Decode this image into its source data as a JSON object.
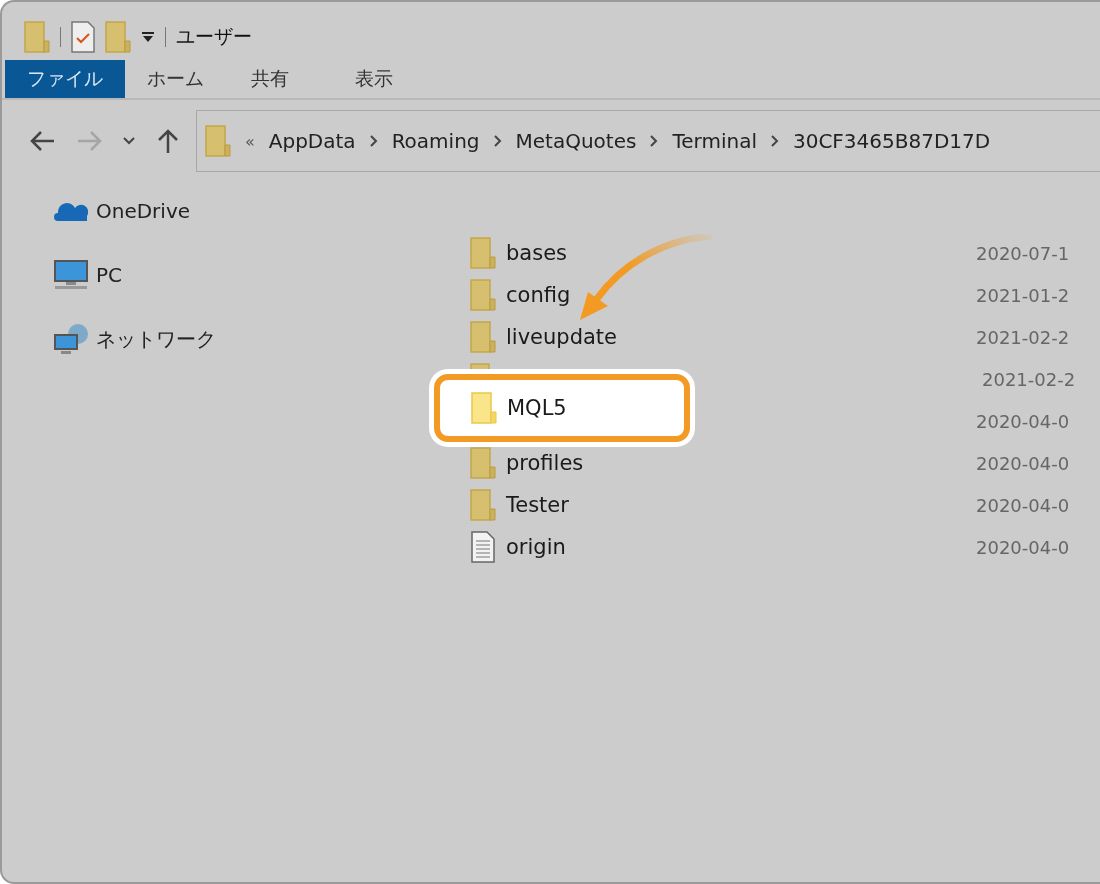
{
  "window": {
    "title": "ユーザー"
  },
  "ribbon_tabs": [
    {
      "label": "ファイル",
      "selected": true
    },
    {
      "label": "ホーム",
      "selected": false
    },
    {
      "label": "共有",
      "selected": false
    },
    {
      "label": "表示",
      "selected": false
    }
  ],
  "address_bar": {
    "overflow": "«",
    "path": [
      "AppData",
      "Roaming",
      "MetaQuotes",
      "Terminal",
      "30CF3465B87D17D"
    ]
  },
  "sidebar": {
    "items": [
      {
        "kind": "cloud",
        "label": "OneDrive"
      },
      {
        "kind": "pc",
        "label": "PC"
      },
      {
        "kind": "network",
        "label": "ネットワーク"
      }
    ]
  },
  "files": [
    {
      "kind": "folder",
      "name": "bases",
      "date": "2020-07-1",
      "highlighted": false
    },
    {
      "kind": "folder",
      "name": "config",
      "date": "2021-01-2",
      "highlighted": false
    },
    {
      "kind": "folder",
      "name": "liveupdate",
      "date": "2021-02-2",
      "highlighted": false
    },
    {
      "kind": "covered",
      "date": "2021-02-2",
      "highlighted": false
    },
    {
      "kind": "folder",
      "name": "MQL5",
      "date": "2020-04-0",
      "highlighted": true
    },
    {
      "kind": "folder",
      "name": "profiles",
      "date": "2020-04-0",
      "highlighted": false
    },
    {
      "kind": "folder",
      "name": "Tester",
      "date": "2020-04-0",
      "highlighted": false
    },
    {
      "kind": "file",
      "name": "origin",
      "date": "2020-04-0",
      "highlighted": false
    }
  ]
}
